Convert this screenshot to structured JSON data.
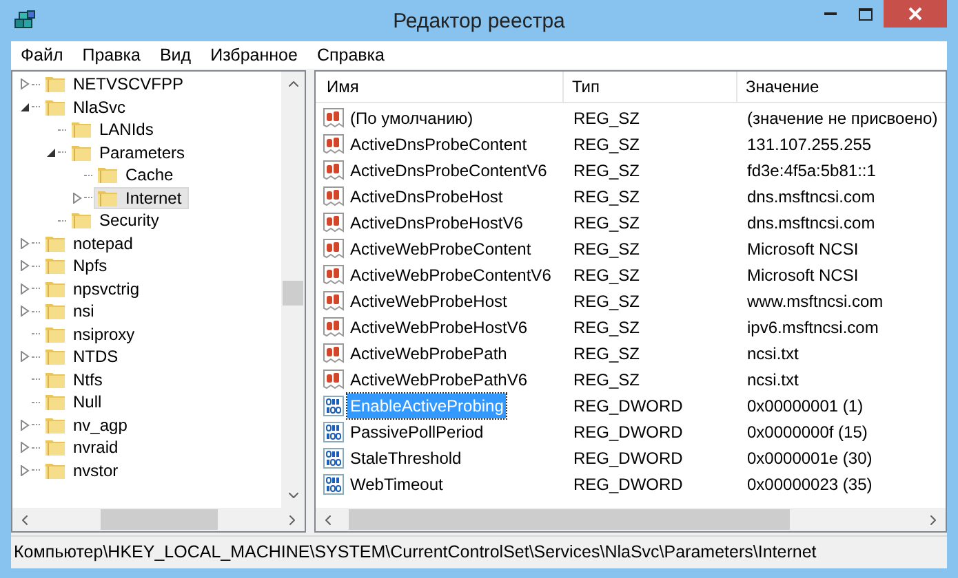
{
  "window": {
    "title": "Редактор реестра"
  },
  "menu": [
    "Файл",
    "Правка",
    "Вид",
    "Избранное",
    "Справка"
  ],
  "tree": [
    {
      "label": "NETVSCVFPP",
      "expanded": false,
      "selected": false
    },
    {
      "label": "NlaSvc",
      "expanded": true,
      "selected": false,
      "children": [
        {
          "label": "LANIds",
          "selected": false
        },
        {
          "label": "Parameters",
          "expanded": true,
          "selected": false,
          "children": [
            {
              "label": "Cache",
              "selected": false
            },
            {
              "label": "Internet",
              "expanded": false,
              "selected": true
            }
          ]
        },
        {
          "label": "Security",
          "selected": false
        }
      ]
    },
    {
      "label": "notepad",
      "expanded": false,
      "selected": false
    },
    {
      "label": "Npfs",
      "expanded": false,
      "selected": false
    },
    {
      "label": "npsvctrig",
      "expanded": false,
      "selected": false
    },
    {
      "label": "nsi",
      "expanded": false,
      "selected": false
    },
    {
      "label": "nsiproxy",
      "selected": false
    },
    {
      "label": "NTDS",
      "expanded": false,
      "selected": false
    },
    {
      "label": "Ntfs",
      "selected": false
    },
    {
      "label": "Null",
      "selected": false
    },
    {
      "label": "nv_agp",
      "expanded": false,
      "selected": false
    },
    {
      "label": "nvraid",
      "expanded": false,
      "selected": false
    },
    {
      "label": "nvstor",
      "expanded": false,
      "selected": false
    }
  ],
  "table": {
    "columns": [
      "Имя",
      "Тип",
      "Значение"
    ],
    "rows": [
      {
        "kind": "string",
        "name": "(По умолчанию)",
        "type": "REG_SZ",
        "value": "(значение не присвоено)",
        "selected": false
      },
      {
        "kind": "string",
        "name": "ActiveDnsProbeContent",
        "type": "REG_SZ",
        "value": "131.107.255.255",
        "selected": false
      },
      {
        "kind": "string",
        "name": "ActiveDnsProbeContentV6",
        "type": "REG_SZ",
        "value": "fd3e:4f5a:5b81::1",
        "selected": false
      },
      {
        "kind": "string",
        "name": "ActiveDnsProbeHost",
        "type": "REG_SZ",
        "value": "dns.msftncsi.com",
        "selected": false
      },
      {
        "kind": "string",
        "name": "ActiveDnsProbeHostV6",
        "type": "REG_SZ",
        "value": "dns.msftncsi.com",
        "selected": false
      },
      {
        "kind": "string",
        "name": "ActiveWebProbeContent",
        "type": "REG_SZ",
        "value": "Microsoft NCSI",
        "selected": false
      },
      {
        "kind": "string",
        "name": "ActiveWebProbeContentV6",
        "type": "REG_SZ",
        "value": "Microsoft NCSI",
        "selected": false
      },
      {
        "kind": "string",
        "name": "ActiveWebProbeHost",
        "type": "REG_SZ",
        "value": "www.msftncsi.com",
        "selected": false
      },
      {
        "kind": "string",
        "name": "ActiveWebProbeHostV6",
        "type": "REG_SZ",
        "value": "ipv6.msftncsi.com",
        "selected": false
      },
      {
        "kind": "string",
        "name": "ActiveWebProbePath",
        "type": "REG_SZ",
        "value": "ncsi.txt",
        "selected": false
      },
      {
        "kind": "string",
        "name": "ActiveWebProbePathV6",
        "type": "REG_SZ",
        "value": "ncsi.txt",
        "selected": false
      },
      {
        "kind": "binary",
        "name": "EnableActiveProbing",
        "type": "REG_DWORD",
        "value": "0x00000001 (1)",
        "selected": true
      },
      {
        "kind": "binary",
        "name": "PassivePollPeriod",
        "type": "REG_DWORD",
        "value": "0x0000000f (15)",
        "selected": false
      },
      {
        "kind": "binary",
        "name": "StaleThreshold",
        "type": "REG_DWORD",
        "value": "0x0000001e (30)",
        "selected": false
      },
      {
        "kind": "binary",
        "name": "WebTimeout",
        "type": "REG_DWORD",
        "value": "0x00000023 (35)",
        "selected": false
      }
    ]
  },
  "status_bar": "Компьютер\\HKEY_LOCAL_MACHINE\\SYSTEM\\CurrentControlSet\\Services\\NlaSvc\\Parameters\\Internet"
}
